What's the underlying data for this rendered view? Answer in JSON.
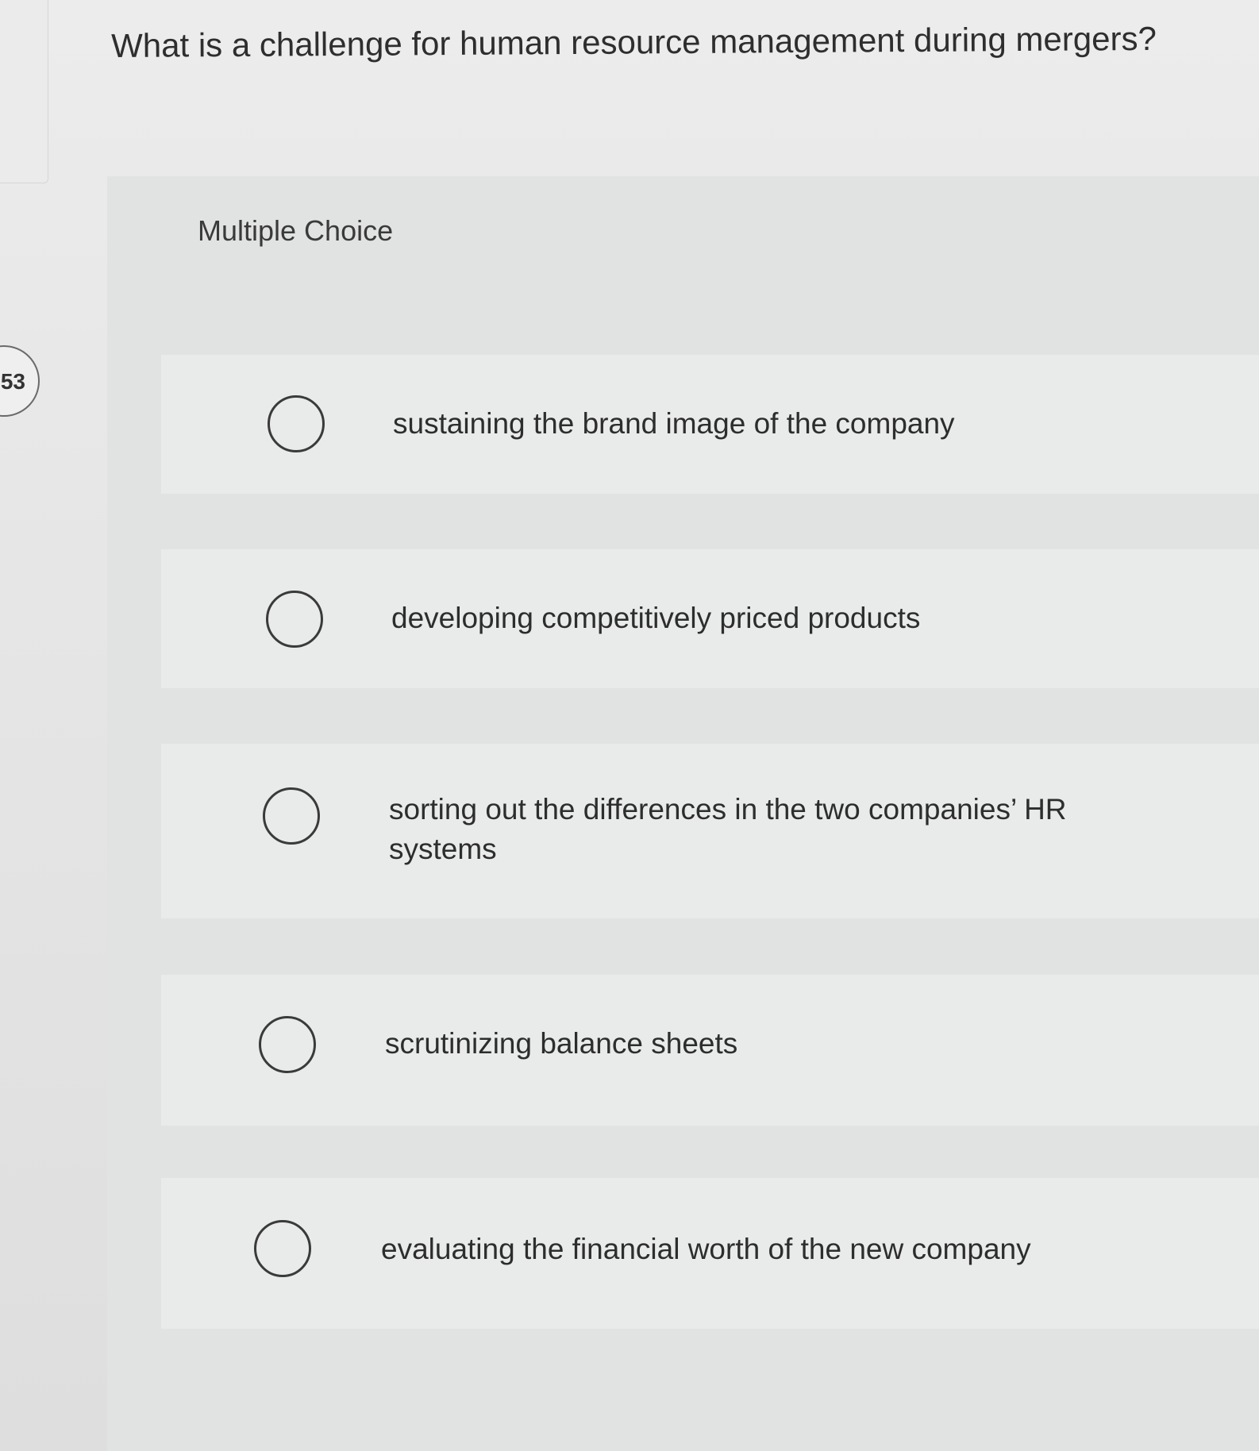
{
  "question": {
    "number": "53",
    "text": "What is a challenge for human resource management during mergers?"
  },
  "panel": {
    "label": "Multiple Choice"
  },
  "options": [
    {
      "label": "sustaining the brand image of the company",
      "selected": false
    },
    {
      "label": "developing competitively priced products",
      "selected": false
    },
    {
      "label": "sorting out the differences in the two companies’ HR systems",
      "selected": false
    },
    {
      "label": "scrutinizing balance sheets",
      "selected": false
    },
    {
      "label": "evaluating the financial worth of the new company",
      "selected": false
    }
  ]
}
